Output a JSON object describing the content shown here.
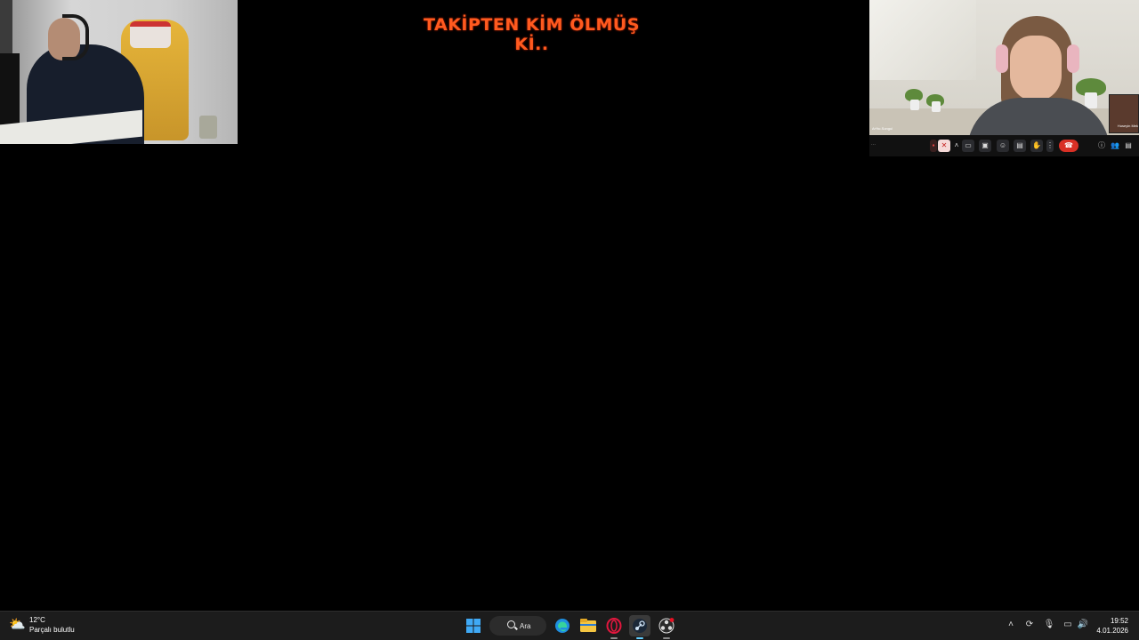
{
  "overlay": {
    "title": "TAKİPTEN KİM ÖLMÜŞ Kİ.."
  },
  "call": {
    "participant_name": "Ar%c.Songul",
    "thumb_name": "Huseyin Mek",
    "controls": [
      "leave-indicator",
      "mic-muted",
      "chevron",
      "camera",
      "present",
      "emoji",
      "captions",
      "raise-hand",
      "more",
      "end-call"
    ],
    "side_controls": [
      "info",
      "people",
      "chat"
    ]
  },
  "taskbar": {
    "weather": {
      "temp": "12°C",
      "condition": "Parçalı bulutlu",
      "icon": "partly-cloudy-icon"
    },
    "search_label": "Ara",
    "apps": [
      "windows-start-icon",
      "edge-icon",
      "file-explorer-icon",
      "opera-gx-icon",
      "steam-icon",
      "obs-icon"
    ],
    "clock": {
      "time": "19:52",
      "date": "4.01.2026"
    },
    "accent_color": "#60cdff"
  }
}
